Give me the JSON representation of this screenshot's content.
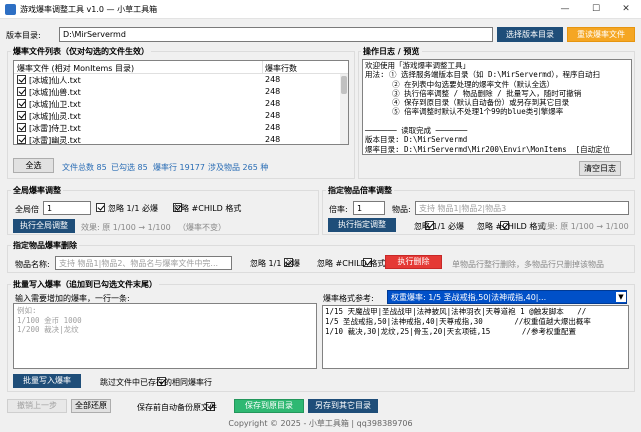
{
  "window": {
    "title": "游戏爆率调整工具 v1.0  —  小草工具箱",
    "minimize": "—",
    "maximize": "☐",
    "close": "✕"
  },
  "version_dir": {
    "label": "版本目录:",
    "value": "D:\\MirServermd",
    "select_button": "选择版本目录",
    "reset_button": "重读爆率文件"
  },
  "file_list": {
    "title": "爆率文件列表（仅对勾选的文件生效）",
    "col_file": "爆率文件 (相对 MonItems 目录)",
    "col_rows": "爆率行数",
    "rows": [
      {
        "name": "[冰城]仙人.txt",
        "count": "248"
      },
      {
        "name": "[冰城]仙兽.txt",
        "count": "248"
      },
      {
        "name": "[冰城]仙卫.txt",
        "count": "248"
      },
      {
        "name": "[冰城]仙灵.txt",
        "count": "248"
      },
      {
        "name": "[冰雷]侍卫.txt",
        "count": "248"
      },
      {
        "name": "[冰雷]幽灵.txt",
        "count": "248"
      }
    ],
    "select_all": "全选",
    "total_files": "文件总数 85",
    "selected": "已勾选 85",
    "drop_rows": "爆率行 19177",
    "items": "涉及物品 265 种"
  },
  "log": {
    "title": "操作日志 / 预览",
    "lines": [
      "欢迎使用「游戏爆率调整工具」",
      "用法: ① 选择服务端版本目录（如 D:\\MirServermd），程序自动扫",
      "      ② 在列表中勾选要处理的爆率文件（默认全选）",
      "      ③ 执行倍率调整 / 物品删除 / 批量写入，随时可撤销",
      "      ④ 保存到原目录（默认自动备份）或另存到其它目录",
      "      ⑤ 倍率调整时默认不处理1个99的blue类引擎爆率",
      "",
      "─────── 读取完成 ───────",
      "版本目录: D:\\MirServermd",
      "爆率目录: D:\\MirServermd\\Mir200\\Envir\\MonItems  [自动定位"
    ],
    "clear_button": "清空日志"
  },
  "global": {
    "title": "全局爆率调整",
    "label": "全局倍",
    "value": "1",
    "ignore_1_1": "忽略 1/1 必爆",
    "ignore_child": "忽略 #CHILD 格式",
    "run_button": "执行全局调整",
    "effect": "效果: 原 1/100 → 1/100",
    "effect_note": "（爆率不变）"
  },
  "item_rate": {
    "title": "指定物品倍率调整",
    "rate_label": "倍率:",
    "rate_value": "1",
    "item_label": "物品:",
    "item_placeholder": "支持 物品1|物品2|物品3",
    "run_button": "执行指定调整",
    "ignore_1_1": "忽略 1/1 必爆",
    "ignore_child": "忽略 #CHILD 格式",
    "effect": "效果: 原 1/100 → 1/100"
  },
  "delete": {
    "title": "指定物品爆率删除",
    "label": "物品名称:",
    "placeholder": "支持 物品1|物品2、物品名与爆率文件中完...",
    "ignore_1_1": "忽略 1/1 必爆",
    "ignore_child": "忽略 #CHILD 格式",
    "run_button": "执行删除",
    "note": "单物品行整行删除，多物品行只删掉该物品"
  },
  "batch": {
    "title": "批量写入爆率（追加到已勾选文件末尾）",
    "input_label": "输入需要增加的爆率，一行一条:",
    "input_placeholder": "例如:\n1/100 金币 1000\n1/200 裁决|龙纹",
    "format_label": "爆率格式参考:",
    "format_selected": "权重爆率: 1/5 圣战戒指,50|法神戒指,40|...",
    "reference_lines": [
      "1/15 天魔战甲|圣战战甲|法神披风|法神羽衣|天尊道袍 1 @触发脚本   //",
      "1/5 圣战戒指,50|法神戒指,40|天尊戒指,30       //权重值越大爆出概率",
      "1/10 裁决,30|龙纹,25|骨玉,20|天玄项链,15       //参考权重配置"
    ],
    "run_button": "批量写入爆率",
    "skip_existing": "跳过文件中已存在的相同爆率行"
  },
  "bottom": {
    "undo": "撤销上一步",
    "restore": "全部还原",
    "auto_backup": "保存前自动备份原文件",
    "save": "保存到原目录",
    "save_as": "另存到其它目录"
  },
  "footer": "Copyright © 2025 - 小草工具箱 | qq398389706",
  "colors": {
    "accent": "#1f4e79",
    "orange": "#f5a623",
    "red": "#e53935",
    "green": "#2eb872",
    "selection": "#0050c8"
  }
}
